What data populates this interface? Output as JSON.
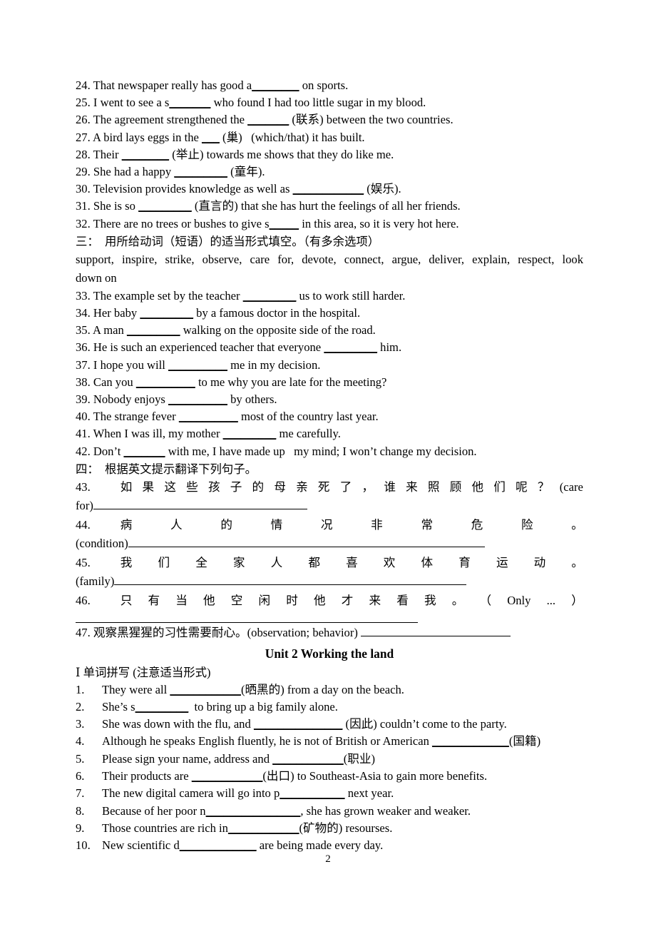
{
  "document": {
    "page_number": "2",
    "unit_title": "Unit 2 Working the land"
  },
  "section_two_items": [
    {
      "num": "24.",
      "pre": "That newspaper really has good a",
      "blank": "________",
      "post": " on sports."
    },
    {
      "num": "25.",
      "pre": "I went to see a s",
      "blank": "_______",
      "post": " who found I had too little sugar in my blood."
    },
    {
      "num": "26.",
      "pre": "The agreement strengthened the ",
      "blank": "_______",
      "post": " (联系) between the two countries."
    },
    {
      "num": "27.",
      "pre": "A bird lays eggs in the ",
      "blank": "___",
      "post": " (巢)   (which/that) it has built."
    },
    {
      "num": "28.",
      "pre": "Their ",
      "blank": "________",
      "post": " (举止) towards me shows that they do like me."
    },
    {
      "num": "29.",
      "pre": "She had a happy ",
      "blank": "_________",
      "post": " (童年)."
    },
    {
      "num": "30.",
      "pre": "Television provides knowledge as well as ",
      "blank": "____________",
      "post": " (娱乐)."
    },
    {
      "num": "31.",
      "pre": "She is so ",
      "blank": "_________",
      "post": " (直言的) that she has hurt the feelings of all her friends."
    },
    {
      "num": "32.",
      "pre": "There are no trees or bushes to give s",
      "blank": "_____",
      "post": " in this area, so it is very hot here."
    }
  ],
  "section_three": {
    "heading": "三：  用所给动词（短语）的适当形式填空。（有多余选项）",
    "wordbank_line1": "support,    inspire,    strike,    observe,    care for, devote, connect, argue, deliver, explain, respect, look",
    "wordbank_line2": "down on",
    "items": [
      {
        "num": "33.",
        "pre": "The example set by the teacher ",
        "blank": "_________",
        "post": " us to work still harder."
      },
      {
        "num": "34.",
        "pre": "Her baby ",
        "blank": "_________",
        "post": " by a famous doctor in the hospital."
      },
      {
        "num": "35.",
        "pre": "A man ",
        "blank": "_________",
        "post": " walking on the opposite side of the road."
      },
      {
        "num": "36.",
        "pre": "He is such an experienced teacher that everyone ",
        "blank": "_________",
        "post": " him."
      },
      {
        "num": "37.",
        "pre": "I hope you will ",
        "blank": "__________",
        "post": " me in my decision."
      },
      {
        "num": "38.",
        "pre": "Can you ",
        "blank": "__________",
        "post": " to me why you are late for the meeting?"
      },
      {
        "num": "39.",
        "pre": "Nobody enjoys ",
        "blank": "__________",
        "post": " by others."
      },
      {
        "num": "40.",
        "pre": "The strange fever ",
        "blank": "__________",
        "post": " most of the country last year."
      },
      {
        "num": "41.",
        "pre": "When I was ill, my mother ",
        "blank": "_________",
        "post": " me carefully."
      },
      {
        "num": "42.",
        "pre": "Don’t ",
        "blank": "_______",
        "post": " with me, I have made up   my mind; I won’t change my decision."
      }
    ]
  },
  "section_four": {
    "heading": "四：  根据英文提示翻译下列句子。",
    "items": [
      {
        "num": "43.",
        "cn_chars": [
          "如",
          "果",
          "这",
          "些",
          "孩",
          "子",
          "的",
          "母",
          "亲",
          "死",
          "了",
          "，",
          "谁",
          "来",
          "照",
          "顾",
          "他",
          "们",
          "呢",
          "？",
          "(care"
        ],
        "hint": "for)",
        "rule_width": 300
      },
      {
        "num": "44.",
        "cn_chars": [
          "病",
          "人",
          "的",
          "情",
          "况",
          "非",
          "常",
          "危",
          "险",
          "。"
        ],
        "hint": "(condition)",
        "rule_width": 500
      },
      {
        "num": "45.",
        "cn_chars": [
          "我",
          "们",
          "全",
          "家",
          "人",
          "都",
          "喜",
          "欢",
          "体",
          "育",
          "运",
          "动",
          "。"
        ],
        "hint": "(family)",
        "rule_width": 494
      },
      {
        "num": "46.",
        "cn_chars": [
          "只",
          "有",
          "当",
          "他",
          "空",
          "闲",
          "时",
          "他",
          "才",
          "来",
          "看",
          "我",
          "。",
          "（",
          "Only",
          "...",
          "）"
        ],
        "hint": "",
        "rule_width": 480
      }
    ],
    "item47": {
      "num": "47.",
      "text": " 观察黑猩猩的习性需要耐心。(observation; behavior) ",
      "rule_width": 210
    }
  },
  "unit2": {
    "part_heading": "Ⅰ 单词拼写 (注意适当形式)",
    "items": [
      {
        "num": "1.",
        "pre": "They were all ",
        "blank": "____________",
        "post": "(晒黑的) from a day on the beach."
      },
      {
        "num": "2.",
        "pre": "She’s s",
        "blank": "_________",
        "post": "  to bring up a big family alone."
      },
      {
        "num": "3.",
        "pre": "She was down with the flu, and ",
        "blank": "_______________",
        "post": " (因此) couldn’t come to the party."
      },
      {
        "num": "4.",
        "pre": "Although he speaks English fluently, he is not of British or American ",
        "blank": "_____________",
        "post": "(国籍)"
      },
      {
        "num": "5.",
        "pre": "Please sign your name, address and ",
        "blank": "____________",
        "post": "(职业)"
      },
      {
        "num": "6.",
        "pre": "Their products are ",
        "blank": "____________",
        "post": "(出口) to Southeast-Asia to gain more benefits."
      },
      {
        "num": "7.",
        "pre": "The new digital camera will go into p",
        "blank": "___________",
        "post": " next year."
      },
      {
        "num": "8.",
        "pre": "Because of her poor n",
        "blank": "________________",
        "post": ", she has grown weaker and weaker."
      },
      {
        "num": "9.",
        "pre": "Those countries are rich in",
        "blank": "____________",
        "post": "(矿物的) resourses."
      },
      {
        "num": "10.",
        "pre": "New scientific d",
        "blank": "_____________",
        "post": " are being made every day."
      }
    ]
  }
}
